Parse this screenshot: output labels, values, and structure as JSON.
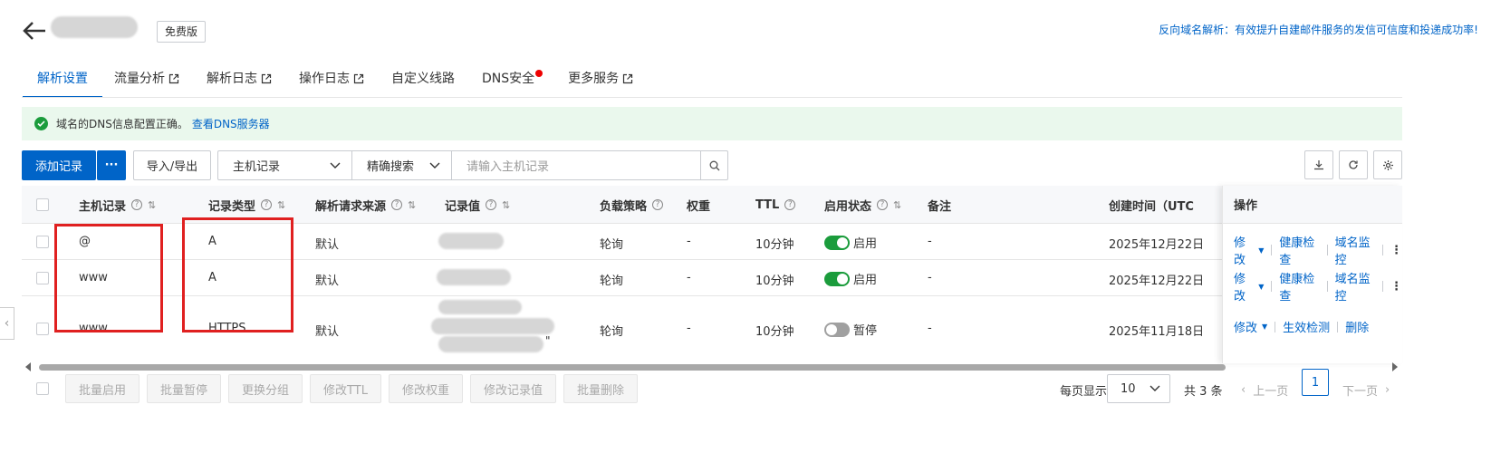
{
  "header": {
    "badge": "免费版",
    "promo": "反向域名解析：有效提升自建邮件服务的发信可信度和投递成功率!"
  },
  "tabs": [
    {
      "label": "解析设置",
      "active": true,
      "external": false,
      "dot": false
    },
    {
      "label": "流量分析",
      "active": false,
      "external": true,
      "dot": false
    },
    {
      "label": "解析日志",
      "active": false,
      "external": true,
      "dot": false
    },
    {
      "label": "操作日志",
      "active": false,
      "external": true,
      "dot": false
    },
    {
      "label": "自定义线路",
      "active": false,
      "external": false,
      "dot": false
    },
    {
      "label": "DNS安全",
      "active": false,
      "external": false,
      "dot": true
    },
    {
      "label": "更多服务",
      "active": false,
      "external": true,
      "dot": false
    }
  ],
  "alert": {
    "text": "域名的DNS信息配置正确。",
    "link": "查看DNS服务器"
  },
  "toolbar": {
    "add": "添加记录",
    "more": "···",
    "import_export": "导入/导出",
    "field_select": "主机记录",
    "mode_select": "精确搜索",
    "search_placeholder": "请输入主机记录"
  },
  "table": {
    "columns": {
      "host": "主机记录",
      "type": "记录类型",
      "source": "解析请求来源",
      "value": "记录值",
      "policy": "负载策略",
      "weight": "权重",
      "ttl": "TTL",
      "status": "启用状态",
      "remark": "备注",
      "created": "创建时间（UTC",
      "ops": "操作"
    },
    "rows": [
      {
        "host": "@",
        "type": "A",
        "source": "默认",
        "value_tail": "",
        "policy": "轮询",
        "weight": "-",
        "ttl": "10分钟",
        "status": "启用",
        "remark": "-",
        "created": "2025年12月22日",
        "op1": "修改",
        "op2": "健康检查",
        "op3": "域名监控"
      },
      {
        "host": "www",
        "type": "A",
        "source": "默认",
        "value_tail": "",
        "policy": "轮询",
        "weight": "-",
        "ttl": "10分钟",
        "status": "启用",
        "remark": "-",
        "created": "2025年12月22日",
        "op1": "修改",
        "op2": "健康检查",
        "op3": "域名监控"
      },
      {
        "host": "www",
        "type": "HTTPS",
        "source": "默认",
        "value_tail": "\"",
        "policy": "轮询",
        "weight": "-",
        "ttl": "10分钟",
        "status": "暂停",
        "remark": "-",
        "created": "2025年11月18日",
        "op1": "修改",
        "op2": "生效检测",
        "op3": "删除"
      }
    ]
  },
  "footer": {
    "batch_buttons": [
      "批量启用",
      "批量暂停",
      "更换分组",
      "修改TTL",
      "修改权重",
      "修改记录值",
      "批量删除"
    ],
    "page_size_label": "每页显示",
    "page_size": "10",
    "total": "共 3 条",
    "prev": "上一页",
    "page": "1",
    "next": "下一页"
  },
  "colors": {
    "accent": "#0064c8",
    "success": "#1b9c3c",
    "highlight_box": "#e02020"
  }
}
